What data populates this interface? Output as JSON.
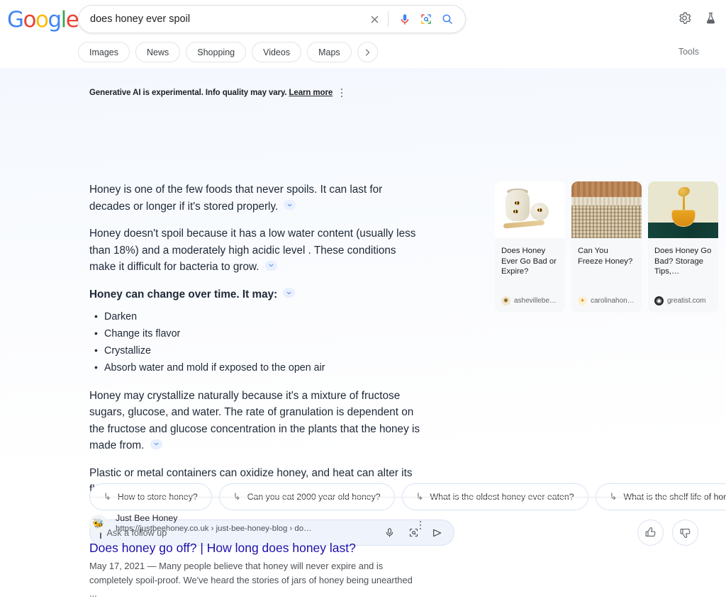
{
  "brand": {
    "logo_letters": [
      "G",
      "o",
      "o",
      "g",
      "l",
      "e"
    ]
  },
  "search": {
    "query": "does honey ever spoil",
    "clear_icon": "close-icon",
    "mic_icon": "microphone-icon",
    "lens_icon": "google-lens-icon",
    "search_icon": "search-icon"
  },
  "tabs": [
    {
      "label": "Images"
    },
    {
      "label": "News"
    },
    {
      "label": "Shopping"
    },
    {
      "label": "Videos"
    },
    {
      "label": "Maps"
    }
  ],
  "tabs_more_icon": "chevron-right-icon",
  "tools_label": "Tools",
  "header_icons": [
    {
      "name": "settings-gear-icon"
    },
    {
      "name": "search-labs-flask-icon"
    }
  ],
  "ai_overview": {
    "disclaimer": "Generative AI is experimental. Info quality may vary.",
    "learn_more": "Learn more",
    "paragraphs": [
      {
        "text": "Honey is one of the few foods that never spoils. It can last for decades or longer if it's stored properly.",
        "bold": false,
        "has_citation": true
      },
      {
        "text": "Honey doesn't spoil because it has a low water content (usually less than 18%) and a moderately high acidic level . These conditions make it difficult for bacteria to grow.",
        "bold": false,
        "has_citation": true
      },
      {
        "text": "Honey can change over time. It may:",
        "bold": true,
        "has_citation": true
      }
    ],
    "bullets": [
      "Darken",
      "Change its flavor",
      "Crystallize",
      "Absorb water and mold if exposed to the open air"
    ],
    "paragraphs_after": [
      {
        "text": "Honey may crystallize naturally because it's a mixture of fructose sugars, glucose, and water. The rate of granulation is dependent on the fructose and glucose concentration in the plants that the honey is made from.",
        "has_citation": true
      },
      {
        "text": "Plastic or metal containers can oxidize honey, and heat can alter its flavor.",
        "has_citation": true
      }
    ],
    "cards": [
      {
        "title": "Does Honey Ever Go Bad or Expire?",
        "source": "ashevillebe…",
        "thumb": "honey-pot-with-bees-image"
      },
      {
        "title": "Can You Freeze Honey?",
        "source": "carolinahon…",
        "thumb": "honeycomb-texture-image"
      },
      {
        "title": "Does Honey Go Bad? Storage Tips,…",
        "source": "greatist.com",
        "thumb": "honey-jar-with-dipper-image"
      }
    ],
    "follow_up_chips": [
      "How to store honey?",
      "Can you eat 2000 year old honey?",
      "What is the oldest honey ever eaten?",
      "What is the shelf life of honey?"
    ],
    "input_placeholder": "Ask a follow up",
    "input_icons": [
      {
        "name": "microphone-icon"
      },
      {
        "name": "google-lens-icon"
      },
      {
        "name": "send-icon"
      }
    ],
    "feedback": [
      {
        "name": "thumbs-up-icon"
      },
      {
        "name": "thumbs-down-icon"
      }
    ]
  },
  "results": [
    {
      "site": "Just Bee Honey",
      "url": "https://justbeehoney.co.uk › just-bee-honey-blog › do…",
      "title": "Does honey go off? | How long does honey last?",
      "snippet": "May 17, 2021 — Many people believe that honey will never expire and is completely spoil-proof. We've heard the stories of jars of honey being unearthed ...",
      "favicon": "bee-favicon"
    }
  ],
  "colors": {
    "link_blue": "#1a0dab",
    "google_blue": "#4285F4",
    "google_red": "#EA4335",
    "google_yellow": "#FBBC05",
    "google_green": "#34A853",
    "citation_chip": "#e8f0fe"
  }
}
